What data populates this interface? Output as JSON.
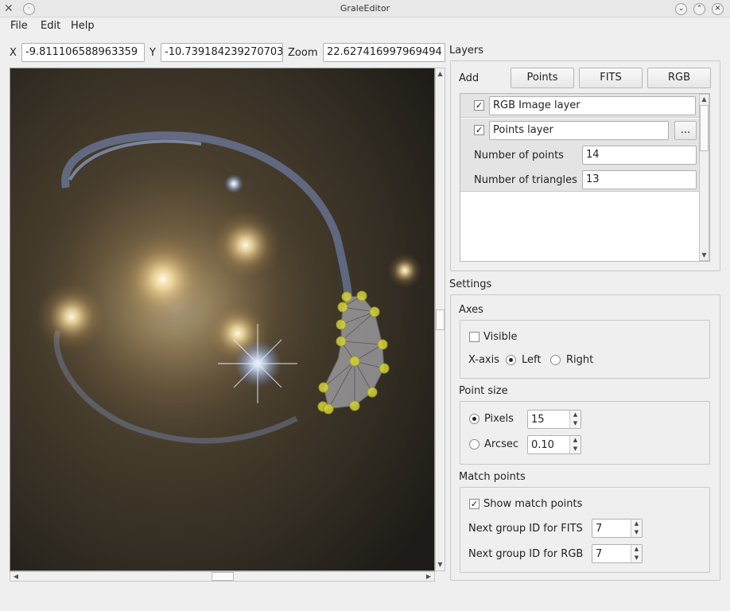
{
  "window": {
    "title": "GraleEditor"
  },
  "menu": [
    "File",
    "Edit",
    "Help"
  ],
  "coords": {
    "x_label": "X",
    "x_value": "-9.811106588963359",
    "y_label": "Y",
    "y_value": "-10.739184239270703",
    "zoom_label": "Zoom",
    "zoom_value": "22.627416997969494"
  },
  "layers": {
    "section_title": "Layers",
    "add_label": "Add",
    "buttons": [
      "Points",
      "FITS",
      "RGB"
    ],
    "items": [
      {
        "name": "RGB Image layer",
        "checked": true
      },
      {
        "name": "Points layer",
        "checked": true,
        "more": "..."
      }
    ],
    "num_points_label": "Number of points",
    "num_points": "14",
    "num_triangles_label": "Number of triangles",
    "num_triangles": "13"
  },
  "settings": {
    "section_title": "Settings",
    "axes": {
      "title": "Axes",
      "visible_label": "Visible",
      "visible_checked": false,
      "xaxis_label": "X-axis",
      "left_label": "Left",
      "right_label": "Right",
      "selected": "Left"
    },
    "point_size": {
      "title": "Point size",
      "pixels_label": "Pixels",
      "pixels_value": "15",
      "arcsec_label": "Arcsec",
      "arcsec_value": "0.10",
      "selected": "Pixels"
    },
    "match_points": {
      "title": "Match points",
      "show_label": "Show match points",
      "show_checked": true,
      "fits_label": "Next group ID for FITS",
      "fits_value": "7",
      "rgb_label": "Next group ID for RGB",
      "rgb_value": "7"
    }
  },
  "colors": {
    "point_fill": "#d4d43a",
    "mesh": "#b8b8c0",
    "sky_dark": "#3a3226"
  }
}
